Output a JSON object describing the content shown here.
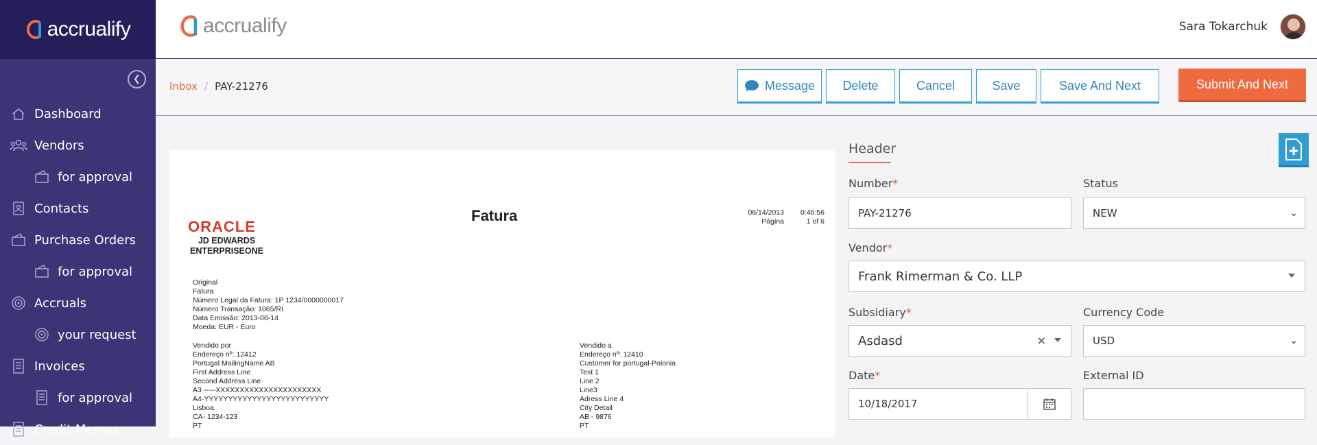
{
  "app": {
    "logo_text": "accrualify",
    "brand_orange": "#ee6a3f",
    "brand_blue": "#2f9dd1",
    "sidebar_bg": "#3a3576"
  },
  "sidebar": {
    "items": [
      {
        "label": "Dashboard",
        "icon": "home-icon",
        "sub": false
      },
      {
        "label": "Vendors",
        "icon": "users-icon",
        "sub": false
      },
      {
        "label": "for approval",
        "icon": "wallet-icon",
        "sub": true
      },
      {
        "label": "Contacts",
        "icon": "contacts-icon",
        "sub": false
      },
      {
        "label": "Purchase Orders",
        "icon": "wallet-icon",
        "sub": false
      },
      {
        "label": "for approval",
        "icon": "wallet-icon",
        "sub": true
      },
      {
        "label": "Accruals",
        "icon": "target-icon",
        "sub": false
      },
      {
        "label": "your request",
        "icon": "target-icon",
        "sub": true
      },
      {
        "label": "Invoices",
        "icon": "invoice-icon",
        "sub": false
      },
      {
        "label": "for approval",
        "icon": "invoice-icon",
        "sub": true
      },
      {
        "label": "Credit Memos",
        "icon": "invoice-icon",
        "sub": false
      }
    ]
  },
  "topbar": {
    "user_name": "Sara Tokarchuk"
  },
  "breadcrumb": {
    "root": "Inbox",
    "separator": "/",
    "current": "PAY-21276"
  },
  "actions": {
    "message": "Message",
    "delete": "Delete",
    "cancel": "Cancel",
    "save": "Save",
    "save_next": "Save And Next",
    "submit_next": "Submit And Next"
  },
  "document": {
    "logo_oracle": "ORACLE",
    "logo_jde_1": "JD EDWARDS",
    "logo_jde_2": "ENTERPRISEONE",
    "title": "Fatura",
    "date": "06/14/2013",
    "time": "0:46:56",
    "page_label": "Página",
    "page_value": "1 of 6",
    "info_lines": "Original\nFatura\nNúmero Legal da Fatura: 1P 1234/0000000017\nNúmero Transação: 1065/RI\nData Emissão: 2013-06-14\nMoeda: EUR - Euro",
    "sold_by": "Vendido por\nEndereço nº: 12412\nPortugal MailingName AB\nFirst Address Line\nSecond Address Line\nA3 -----XXXXXXXXXXXXXXXXXXXXXX\nA4-YYYYYYYYYYYYYYYYYYYYYYYYYY\nLisboa\nCA- 1234-123\nPT",
    "sold_to": "Vendido a\nEndereço nº: 12410\nCustomer for portugal-Polonia\nTest 1\nLine 2\nLine3\nAdress Line 4\nCity Detail\nAB - 9876\nPT"
  },
  "form": {
    "header": "Header",
    "number_label": "Number",
    "number_value": "PAY-21276",
    "status_label": "Status",
    "status_value": "NEW",
    "vendor_label": "Vendor",
    "vendor_value": "Frank Rimerman & Co. LLP",
    "subsidiary_label": "Subsidiary",
    "subsidiary_value": "Asdasd",
    "currency_label": "Currency Code",
    "currency_value": "USD",
    "date_label": "Date",
    "date_value": "10/18/2017",
    "external_label": "External ID",
    "external_value": "",
    "required_mark": "*"
  }
}
